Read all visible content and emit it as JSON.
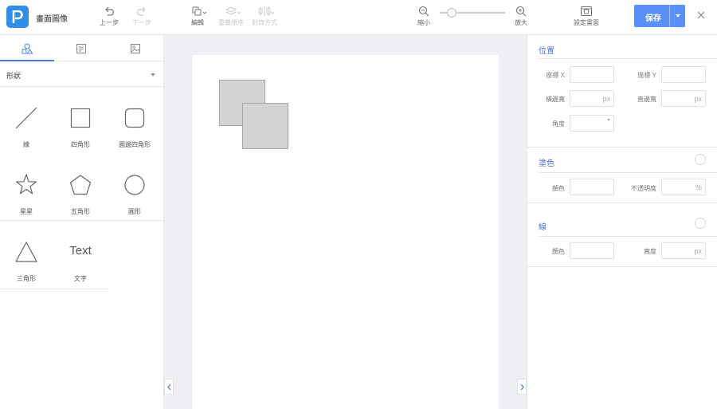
{
  "app": {
    "title": "畫面圖像"
  },
  "toolbar": {
    "undo": "上一步",
    "redo": "下一步",
    "edit": "編輯",
    "layer_order": "重疊順序",
    "align": "對齊方式",
    "zoom_out": "縮小",
    "zoom_in": "放大",
    "zoom_level": 0.18,
    "set_screen": "設定畫面",
    "save": "保存"
  },
  "left_panel": {
    "tabs": [
      {
        "icon": "shapes-icon",
        "active": true
      },
      {
        "icon": "template-icon",
        "active": false
      },
      {
        "icon": "image-icon",
        "active": false
      }
    ],
    "category": "形狀",
    "shapes": [
      {
        "label": "線",
        "icon": "line-icon"
      },
      {
        "label": "四角形",
        "icon": "square-icon"
      },
      {
        "label": "圓邊四角形",
        "icon": "rounded-square-icon"
      },
      {
        "label": "星星",
        "icon": "star-icon"
      },
      {
        "label": "五角形",
        "icon": "pentagon-icon"
      },
      {
        "label": "圓形",
        "icon": "circle-icon"
      },
      {
        "label": "三角形",
        "icon": "triangle-icon"
      },
      {
        "label": "文字",
        "icon": "text-icon",
        "glyph": "Text"
      }
    ]
  },
  "properties": {
    "position": {
      "title": "位置",
      "x_label": "座標 X",
      "y_label": "座標 Y",
      "width_label": "橫邊寬",
      "height_label": "直邊寬",
      "angle_label": "角度",
      "unit": "px"
    },
    "fill": {
      "title": "塗色",
      "color_label": "顏色",
      "opacity_label": "不透明度",
      "opacity_unit": "%"
    },
    "stroke": {
      "title": "線",
      "color_label": "顏色",
      "width_label": "寬度",
      "unit": "px"
    }
  },
  "colors": {
    "accent": "#5b8ff9",
    "logo": "#2f8ee8",
    "section_title": "#4a6fd0",
    "shape_fill": "#d3d3d3"
  }
}
